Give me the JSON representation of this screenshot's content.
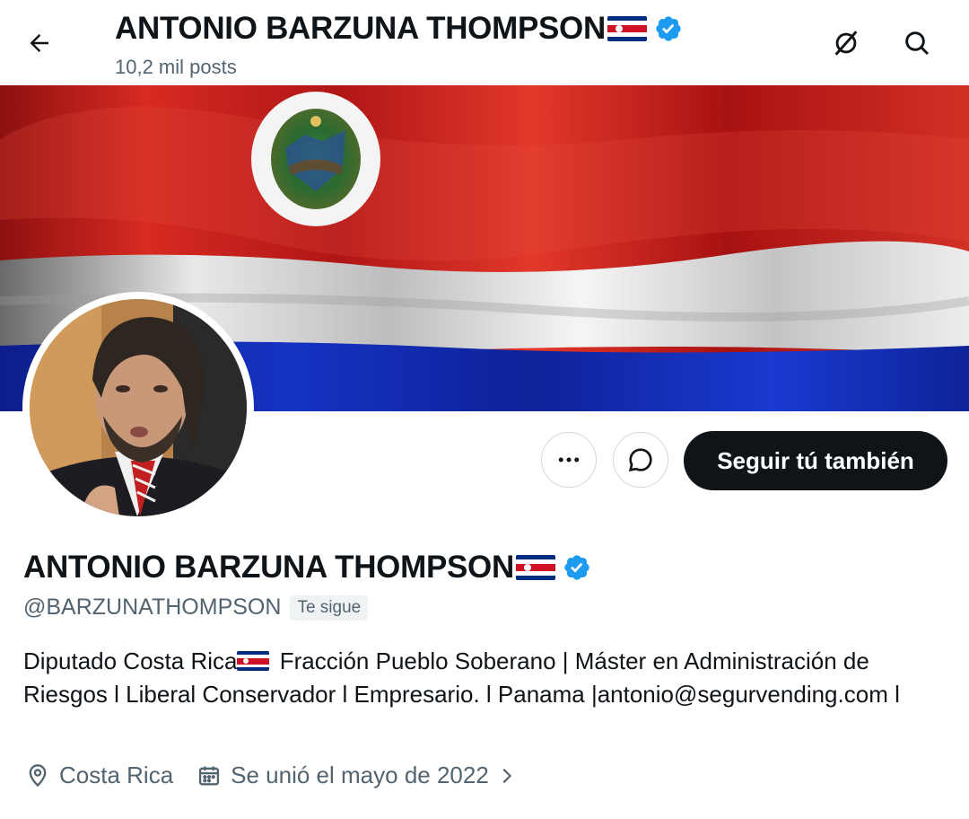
{
  "header": {
    "title": "ANTONIO BARZUNA THOMPSON",
    "posts_count": "10,2 mil posts",
    "icons": [
      "back-arrow-icon",
      "grok-icon",
      "search-icon"
    ]
  },
  "profile": {
    "display_name": "ANTONIO BARZUNA THOMPSON",
    "handle": "@BARZUNATHOMPSON",
    "follows_you_badge": "Te sigue",
    "bio_line1_a": "Diputado Costa Rica",
    "bio_line1_b": " Fracción Pueblo Soberano | Máster en Administración de Riesgos l Liberal Conservador l Empresario. l Panama |antonio@segurvending.com l",
    "location": "Costa Rica",
    "joined": "Se unió el mayo de 2022",
    "verified": true
  },
  "actions": {
    "follow_label": "Seguir tú también",
    "more_icon": "more-icon",
    "message_icon": "message-icon"
  },
  "colors": {
    "verified": "#1d9bf0",
    "text_primary": "#0f1419",
    "text_secondary": "#536471",
    "button_dark": "#0f1419",
    "flag_blue": "#002b7f",
    "flag_red": "#ce1126"
  }
}
